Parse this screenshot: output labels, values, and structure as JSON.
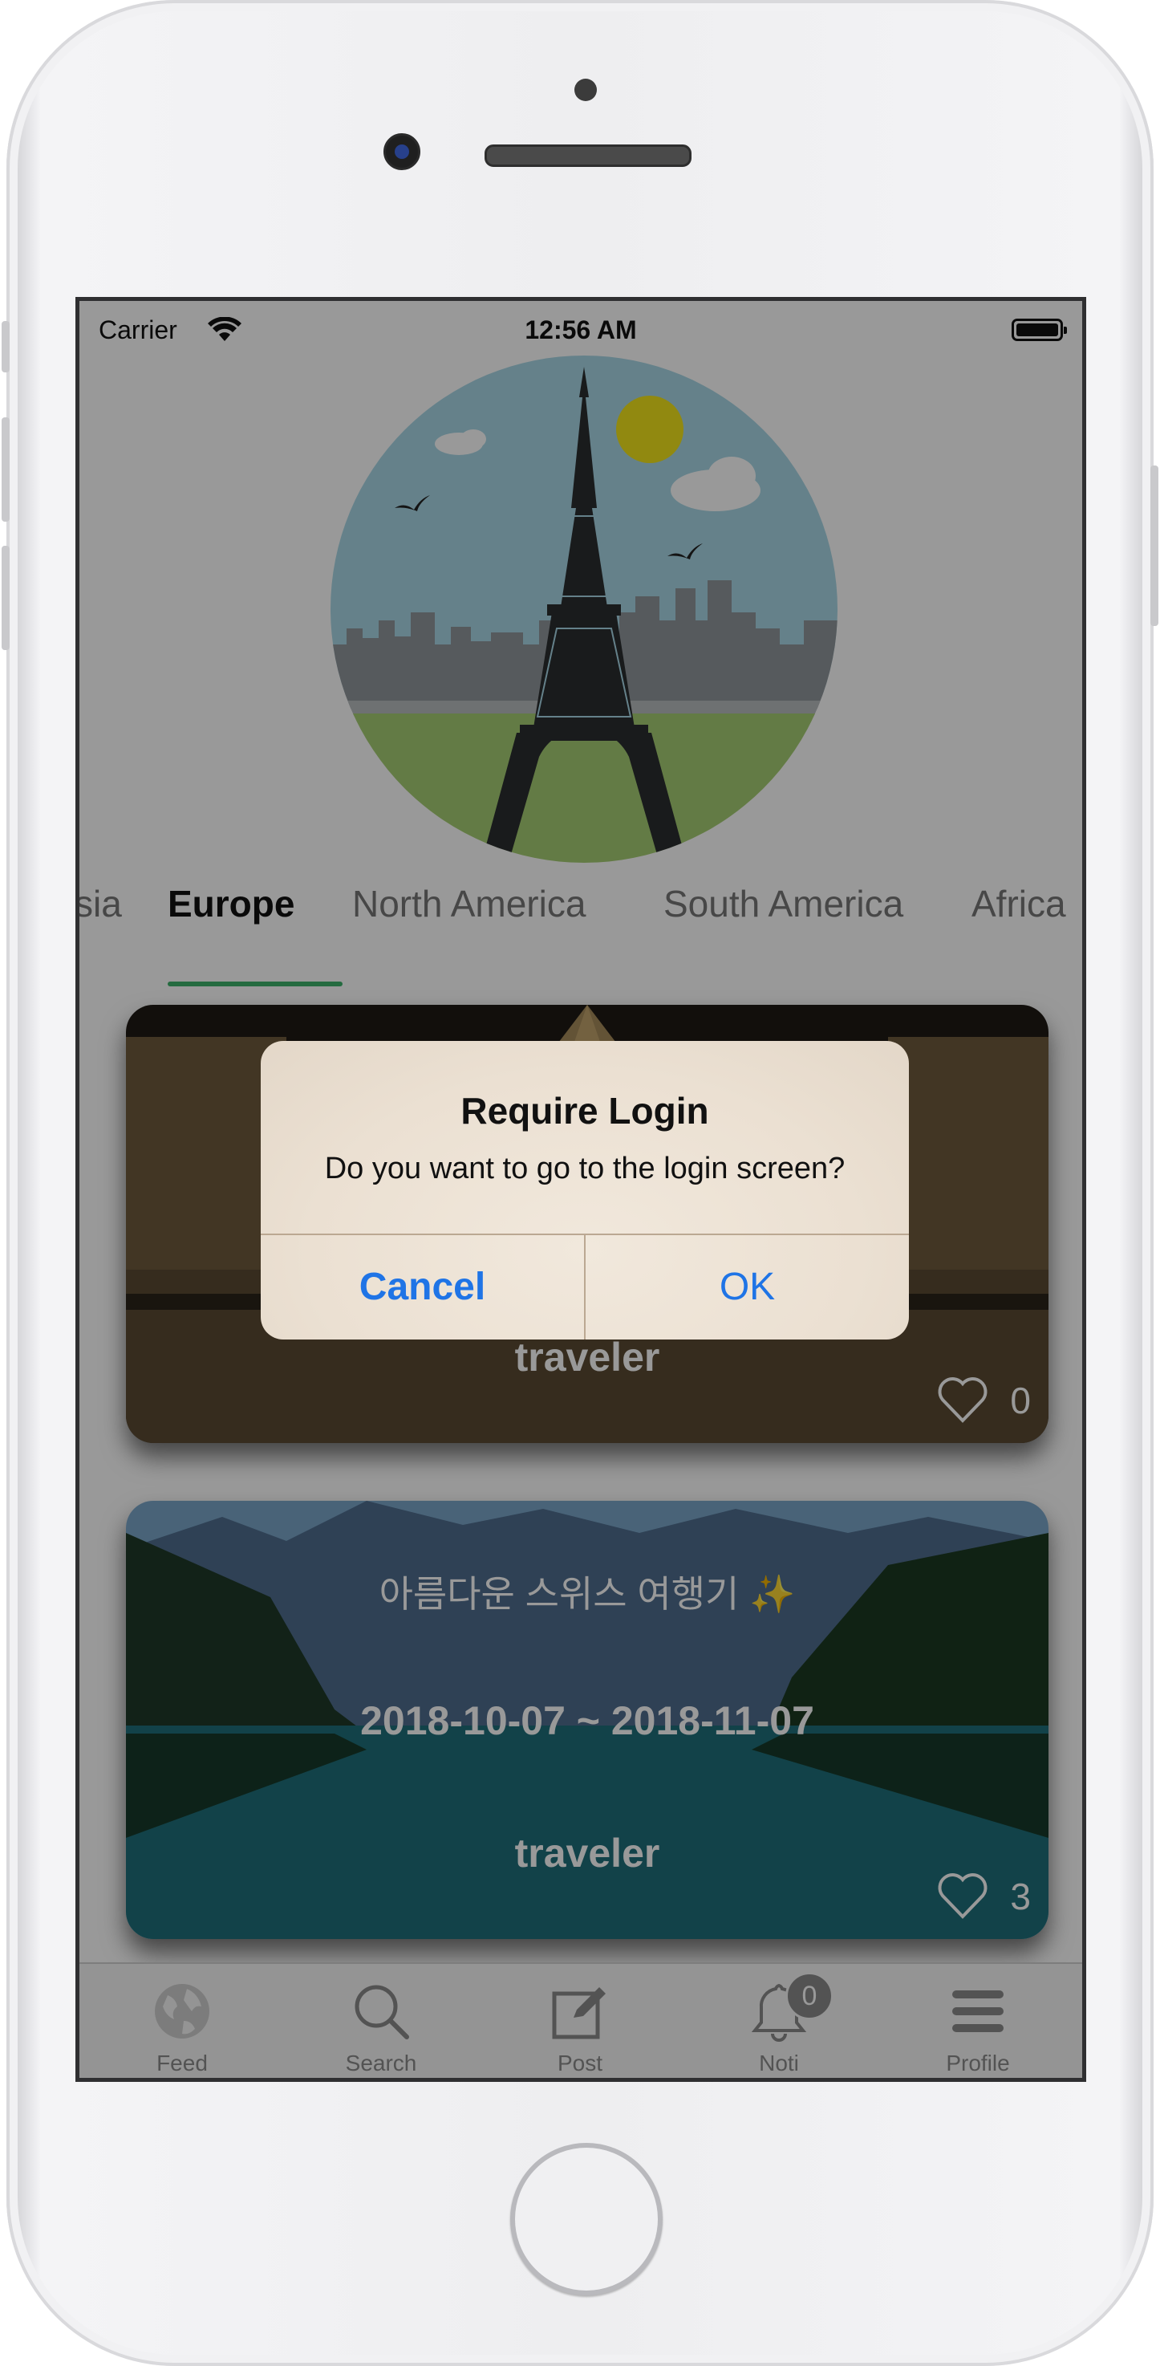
{
  "status_bar": {
    "carrier": "Carrier",
    "time": "12:56 AM"
  },
  "categories": {
    "tabs": [
      {
        "label": "sia",
        "active": false
      },
      {
        "label": "Europe",
        "active": true
      },
      {
        "label": "North America",
        "active": false
      },
      {
        "label": "South America",
        "active": false
      },
      {
        "label": "Africa",
        "active": false
      }
    ],
    "accent_color": "#3fb36c"
  },
  "feed": {
    "cards": [
      {
        "title": "",
        "dates": "",
        "author": "traveler",
        "likes": "0"
      },
      {
        "title": "아름다운 스위스 여행기 ✨",
        "dates": "2018-10-07 ~ 2018-11-07",
        "author": "traveler",
        "likes": "3"
      }
    ]
  },
  "tab_bar": {
    "items": [
      {
        "label": "Feed",
        "icon": "globe-icon"
      },
      {
        "label": "Search",
        "icon": "search-icon"
      },
      {
        "label": "Post",
        "icon": "compose-icon"
      },
      {
        "label": "Noti",
        "icon": "bell-icon",
        "badge": "0"
      },
      {
        "label": "Profile",
        "icon": "menu-icon"
      }
    ]
  },
  "alert": {
    "title": "Require Login",
    "message": "Do you want to go to the login screen?",
    "cancel_label": "Cancel",
    "ok_label": "OK",
    "button_color": "#1f74e6"
  }
}
